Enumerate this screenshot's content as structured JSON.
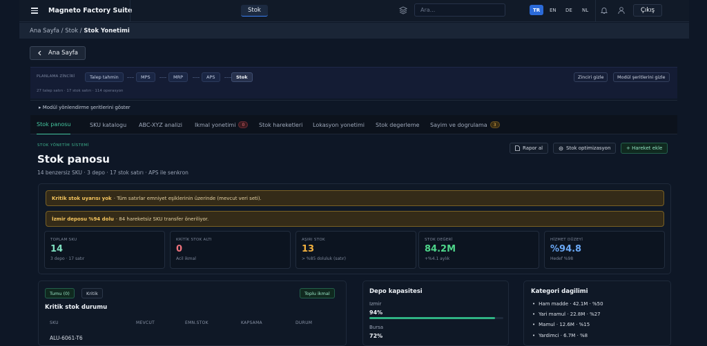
{
  "app": {
    "title": "Magneto Factory Suite",
    "active_module": "Stok"
  },
  "search": {
    "placeholder": "Ara..."
  },
  "languages": [
    "TR",
    "EN",
    "DE",
    "NL"
  ],
  "active_language": "TR",
  "logout_label": "Çıkış",
  "breadcrumb": {
    "home": "Ana Sayfa",
    "sep1": " / ",
    "module": "Stok",
    "sep2": " / ",
    "current": "Stok Yonetimi"
  },
  "back_button": "Ana Sayfa",
  "planning_chain": {
    "label": "PLANLAMA ZİNCİRİ",
    "steps": [
      "Talep tahmin",
      "MPS",
      "MRP",
      "APS",
      "Stok"
    ],
    "active_step": "Stok",
    "meta": "27 talep satırı · 17 stok satırı · 114 operasyon",
    "hide_chain": "Zinciri gizle",
    "hide_strips": "Modül şeritlerini gizle"
  },
  "strip_toggle": "▸ Modül yönlendirme şeritlerini göster",
  "tabs": [
    {
      "label": "Stok panosu",
      "active": true
    },
    {
      "label": "SKU katalogu"
    },
    {
      "label": "ABC-XYZ analizi"
    },
    {
      "label": "Ikmal yonetimi",
      "badge": "0"
    },
    {
      "label": "Stok hareketleri"
    },
    {
      "label": "Lokasyon yonetimi"
    },
    {
      "label": "Stok degerleme"
    },
    {
      "label": "Sayim ve dogrulama",
      "badge": "3"
    }
  ],
  "page": {
    "eyebrow": "STOK YÖNETİM SİSTEMİ",
    "title": "Stok panosu",
    "subtitle": "14 benzersiz SKU · 3 depo · 17 stok satırı · APS ile senkron"
  },
  "actions": {
    "report": "Rapor al",
    "optimize": "Stok optimizasyon",
    "add_move": "+ Hareket ekle"
  },
  "alerts": [
    {
      "bold": "Kritik stok uyarısı yok",
      "text": "· Tüm satırlar emniyet eşiklerinin üzerinde (mevcut veri seti)."
    },
    {
      "bold": "İzmir deposu %94 dolu",
      "text": "· 84 hareketsiz SKU transfer öneriliyor."
    }
  ],
  "kpis": [
    {
      "label": "TOPLAM SKU",
      "value": "14",
      "sub": "3 depo · 17 satır",
      "color": "#7fe0c0"
    },
    {
      "label": "KRİTİK STOK ALTI",
      "value": "0",
      "sub": "Acil ikmal",
      "color": "#f0737d"
    },
    {
      "label": "AŞIRI STOK",
      "value": "13",
      "sub": "> %85 doluluk (satır)",
      "color": "#f2b13f"
    },
    {
      "label": "STOK DEĞERİ",
      "value": "84.2M",
      "sub": "+%4.1 aylık",
      "color": "#4ed68a"
    },
    {
      "label": "HİZMET DÜZEYİ",
      "value": "%94.8",
      "sub": "Hedef %98",
      "color": "#6aa8f5"
    }
  ],
  "critical": {
    "filters": [
      "Tumu (0)",
      "Kritik"
    ],
    "bulk_button": "Toplu ikmal",
    "title": "Kritik stok durumu",
    "columns": [
      "SKU",
      "MEVCUT",
      "EMN.STOK",
      "KAPSAMA",
      "DURUM"
    ],
    "rows": [
      {
        "sku": "ALU-6061-T6"
      }
    ]
  },
  "warehouse": {
    "title": "Depo kapasitesi",
    "items": [
      {
        "name": "Izmir",
        "pct_label": "94%",
        "fill": 0.94
      },
      {
        "name": "Bursa",
        "pct_label": "72%",
        "fill": 0.72
      }
    ]
  },
  "categories": {
    "title": "Kategori dagilimi",
    "items": [
      "Ham madde · 42.1M · %50",
      "Yari mamul · 22.8M · %27",
      "Mamul · 12.6M · %15",
      "Yardimci · 6.7M · %8"
    ]
  }
}
